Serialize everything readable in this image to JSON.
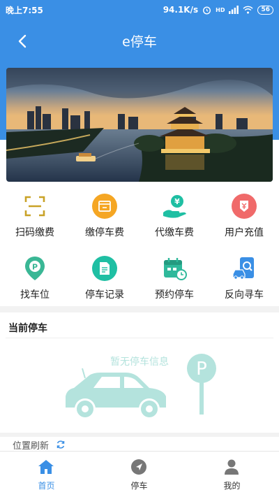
{
  "status_bar": {
    "time": "晚上7:55",
    "network_speed": "94.1K/s",
    "signal_label": "HD",
    "battery": "56"
  },
  "header": {
    "title": "e停车"
  },
  "services": [
    {
      "label": "扫码缴费",
      "icon": "scan-icon",
      "color": "#c9a227"
    },
    {
      "label": "缴停车费",
      "icon": "wallet-icon",
      "color": "#f5a623"
    },
    {
      "label": "代缴车费",
      "icon": "hand-coin-icon",
      "color": "#1fbfa3"
    },
    {
      "label": "用户充值",
      "icon": "recharge-icon",
      "color": "#f06a6a"
    },
    {
      "label": "找车位",
      "icon": "parking-pin-icon",
      "color": "#3ab795"
    },
    {
      "label": "停车记录",
      "icon": "record-icon",
      "color": "#1fbfa3"
    },
    {
      "label": "预约停车",
      "icon": "calendar-clock-icon",
      "color": "#2fb99b"
    },
    {
      "label": "反向寻车",
      "icon": "car-search-icon",
      "color": "#3a8fe5"
    }
  ],
  "current_parking": {
    "title": "当前停车",
    "empty_text": "暂无停车信息",
    "sign_letter": "P"
  },
  "refresh": {
    "label": "位置刷新"
  },
  "tabs": [
    {
      "label": "首页",
      "icon": "home-icon",
      "active": true
    },
    {
      "label": "停车",
      "icon": "navigation-icon",
      "active": false
    },
    {
      "label": "我的",
      "icon": "user-icon",
      "active": false
    }
  ],
  "colors": {
    "primary": "#3a8fe5",
    "empty_accent": "#b4e3dd"
  }
}
